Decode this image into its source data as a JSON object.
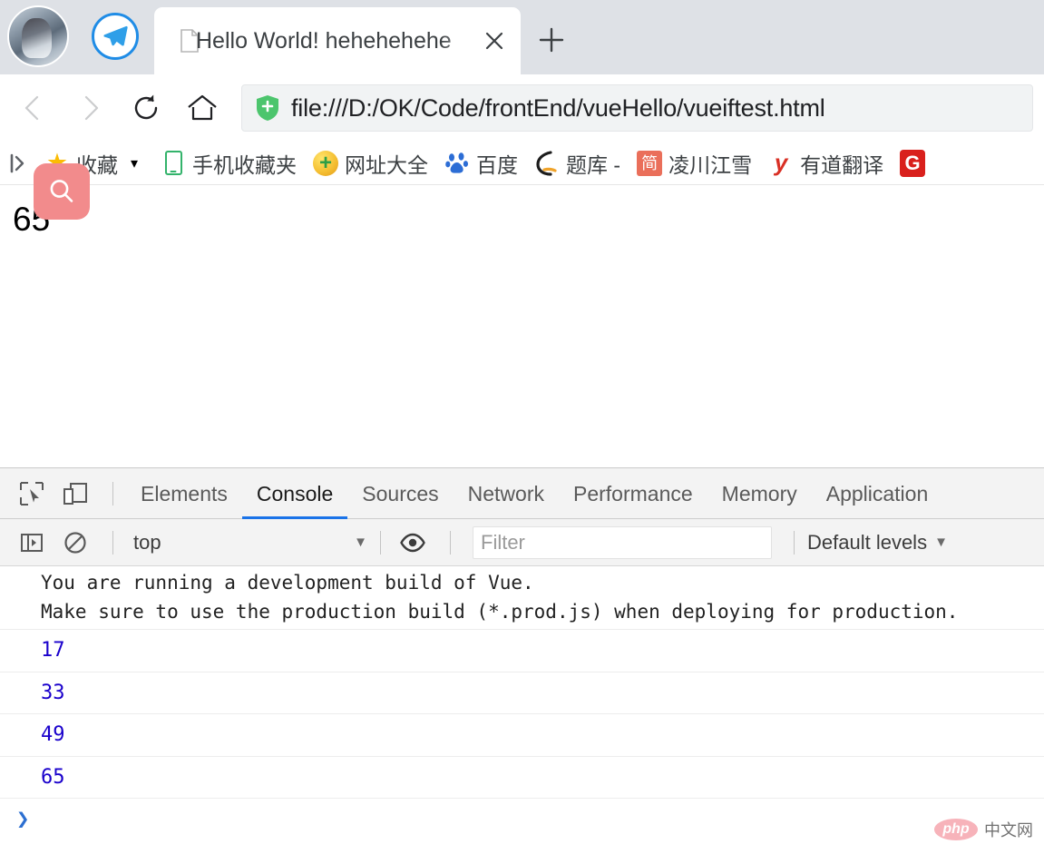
{
  "browser": {
    "profile_avatar": "profile-avatar",
    "telegram_icon": "telegram-icon",
    "tab": {
      "favicon": "page-favicon",
      "title": "Hello World! hehehehehe",
      "close_label": "×"
    },
    "new_tab_label": "+",
    "nav": {
      "back": "back-arrow",
      "forward": "forward-arrow",
      "reload": "reload-icon",
      "home": "home-icon"
    },
    "omnibox": {
      "security_icon": "green-shield-icon",
      "url": "file:///D:/OK/Code/frontEnd/vueHello/vueiftest.html"
    }
  },
  "bookmarks": {
    "panel_toggle": "bookmarks-panel-toggle-icon",
    "items": [
      {
        "label": "收藏",
        "icon": "star-icon",
        "caret": "▾"
      },
      {
        "label": "手机收藏夹",
        "icon": "phone-icon",
        "caret": ""
      },
      {
        "label": "网址大全",
        "icon": "hao123-icon",
        "caret": ""
      },
      {
        "label": "百度",
        "icon": "baidu-icon",
        "caret": ""
      },
      {
        "label": "题库 -",
        "icon": "tiku-icon",
        "caret": ""
      },
      {
        "label": "凌川江雪",
        "icon": "jianshu-icon",
        "caret": ""
      },
      {
        "label": "有道翻译",
        "icon": "youdao-icon",
        "caret": ""
      },
      {
        "label": "",
        "icon": "g-icon",
        "caret": ""
      }
    ]
  },
  "search_overlay": {
    "icon": "search-icon",
    "color": "#f28b8c"
  },
  "page": {
    "text": "65"
  },
  "devtools": {
    "inspect_icon": "inspect-element-icon",
    "device_icon": "device-toolbar-icon",
    "tabs": [
      {
        "label": "Elements",
        "active": false
      },
      {
        "label": "Console",
        "active": true
      },
      {
        "label": "Sources",
        "active": false
      },
      {
        "label": "Network",
        "active": false
      },
      {
        "label": "Performance",
        "active": false
      },
      {
        "label": "Memory",
        "active": false
      },
      {
        "label": "Application",
        "active": false
      }
    ],
    "active_tab_color": "#1a73e8",
    "filterbar": {
      "sidebar_icon": "console-sidebar-icon",
      "clear_icon": "clear-console-icon",
      "context": "top",
      "context_caret": "▼",
      "eye_icon": "live-expression-eye-icon",
      "filter_placeholder": "Filter",
      "filter_value": "",
      "levels": "Default levels",
      "levels_caret": "▼"
    },
    "console": {
      "messages": [
        {
          "type": "text",
          "text": "You are running a development build of Vue."
        },
        {
          "type": "text",
          "text": "Make sure to use the production build (*.prod.js) when deploying for production."
        },
        {
          "type": "number",
          "text": "17"
        },
        {
          "type": "number",
          "text": "33"
        },
        {
          "type": "number",
          "text": "49"
        },
        {
          "type": "number",
          "text": "65"
        }
      ],
      "prompt": "❯",
      "number_color": "#1a01cc"
    }
  },
  "watermark": {
    "logo": "php",
    "text": "中文网"
  }
}
